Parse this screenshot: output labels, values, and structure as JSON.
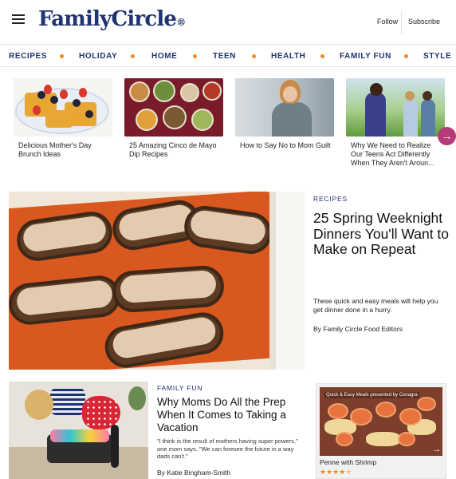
{
  "header": {
    "logo": "FamilyCircle",
    "logo_mark": "®",
    "follow": "Follow",
    "subscribe": "Subscribe"
  },
  "nav": {
    "items": [
      "RECIPES",
      "HOLIDAY",
      "HOME",
      "TEEN",
      "HEALTH",
      "FAMILY FUN",
      "STYLE"
    ],
    "accent_color": "#1f3370",
    "separator_color": "#f08a24"
  },
  "carousel": {
    "cards": [
      {
        "caption": "Delicious Mother's Day Brunch Ideas"
      },
      {
        "caption": "25 Amazing Cinco de Mayo Dip Recipes"
      },
      {
        "caption": "How to Say No to Mom Guilt"
      },
      {
        "caption": "Why We Need to Realize Our Teens Act Differently When They Aren't Aroun..."
      }
    ],
    "next_icon": "arrow-right-icon",
    "next_color": "#b53a77"
  },
  "feature": {
    "label": "RECIPES",
    "title": "25 Spring Weeknight Dinners You'll Want to Make on Repeat",
    "description": "These quick and easy meals will help you get dinner done in a hurry.",
    "byline": "By Family Circle Food Editors"
  },
  "article2": {
    "label": "FAMILY FUN",
    "title": "Why Moms Do All the Prep When It Comes to Taking a Vacation",
    "quote": "\"I think is the result of mothers having super powers,\" one mom says. \"We can foresee the future in a way dads can't.\"",
    "byline": "By Katie Bingham-Smith"
  },
  "widget": {
    "banner": "Quick & Easy Meals presented by Conagra",
    "title": "Penne with Shrimp",
    "rating": 4.5,
    "rating_max": 5,
    "stars_text": "★★★★",
    "half_star": "★",
    "next_icon": "arrow-right-icon"
  }
}
